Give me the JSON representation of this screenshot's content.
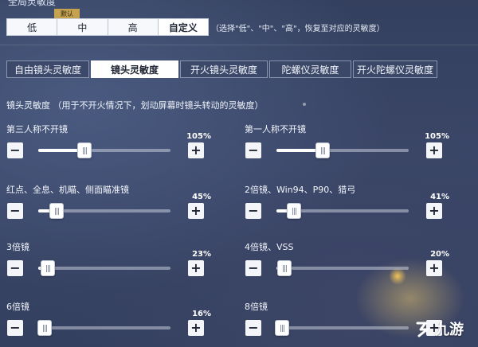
{
  "top": {
    "title": "全局灵敏度",
    "presets": [
      "低",
      "中",
      "高",
      "自定义"
    ],
    "active_preset": 3,
    "default_badge": "默认",
    "hint": "（选择\"低\"、\"中\"、\"高\"，恢复至对应的灵敏度）"
  },
  "tabs": [
    "自由镜头灵敏度",
    "镜头灵敏度",
    "开火镜头灵敏度",
    "陀螺仪灵敏度",
    "开火陀螺仪灵敏度"
  ],
  "active_tab": 1,
  "section": {
    "title": "镜头灵敏度 （用于不开火情况下，划动屏幕时镜头转动的灵敏度）"
  },
  "sliders": [
    {
      "label": "第三人称不开镜",
      "value": "105%",
      "level": 0.35
    },
    {
      "label": "第一人称不开镜",
      "value": "105%",
      "level": 0.35
    },
    {
      "label": "红点、全息、机瞄、侧面瞄准镜",
      "value": "45%",
      "level": 0.14
    },
    {
      "label": "2倍镜、Win94、P90、猎弓",
      "value": "41%",
      "level": 0.13
    },
    {
      "label": "3倍镜",
      "value": "23%",
      "level": 0.07
    },
    {
      "label": "4倍镜、VSS",
      "value": "20%",
      "level": 0.06
    },
    {
      "label": "6倍镜",
      "value": "16%",
      "level": 0.05
    },
    {
      "label": "8倍镜",
      "value": "",
      "level": 0.04
    }
  ],
  "buttons": {
    "minus": "−",
    "plus": "+"
  },
  "watermark": {
    "text": "九游"
  }
}
